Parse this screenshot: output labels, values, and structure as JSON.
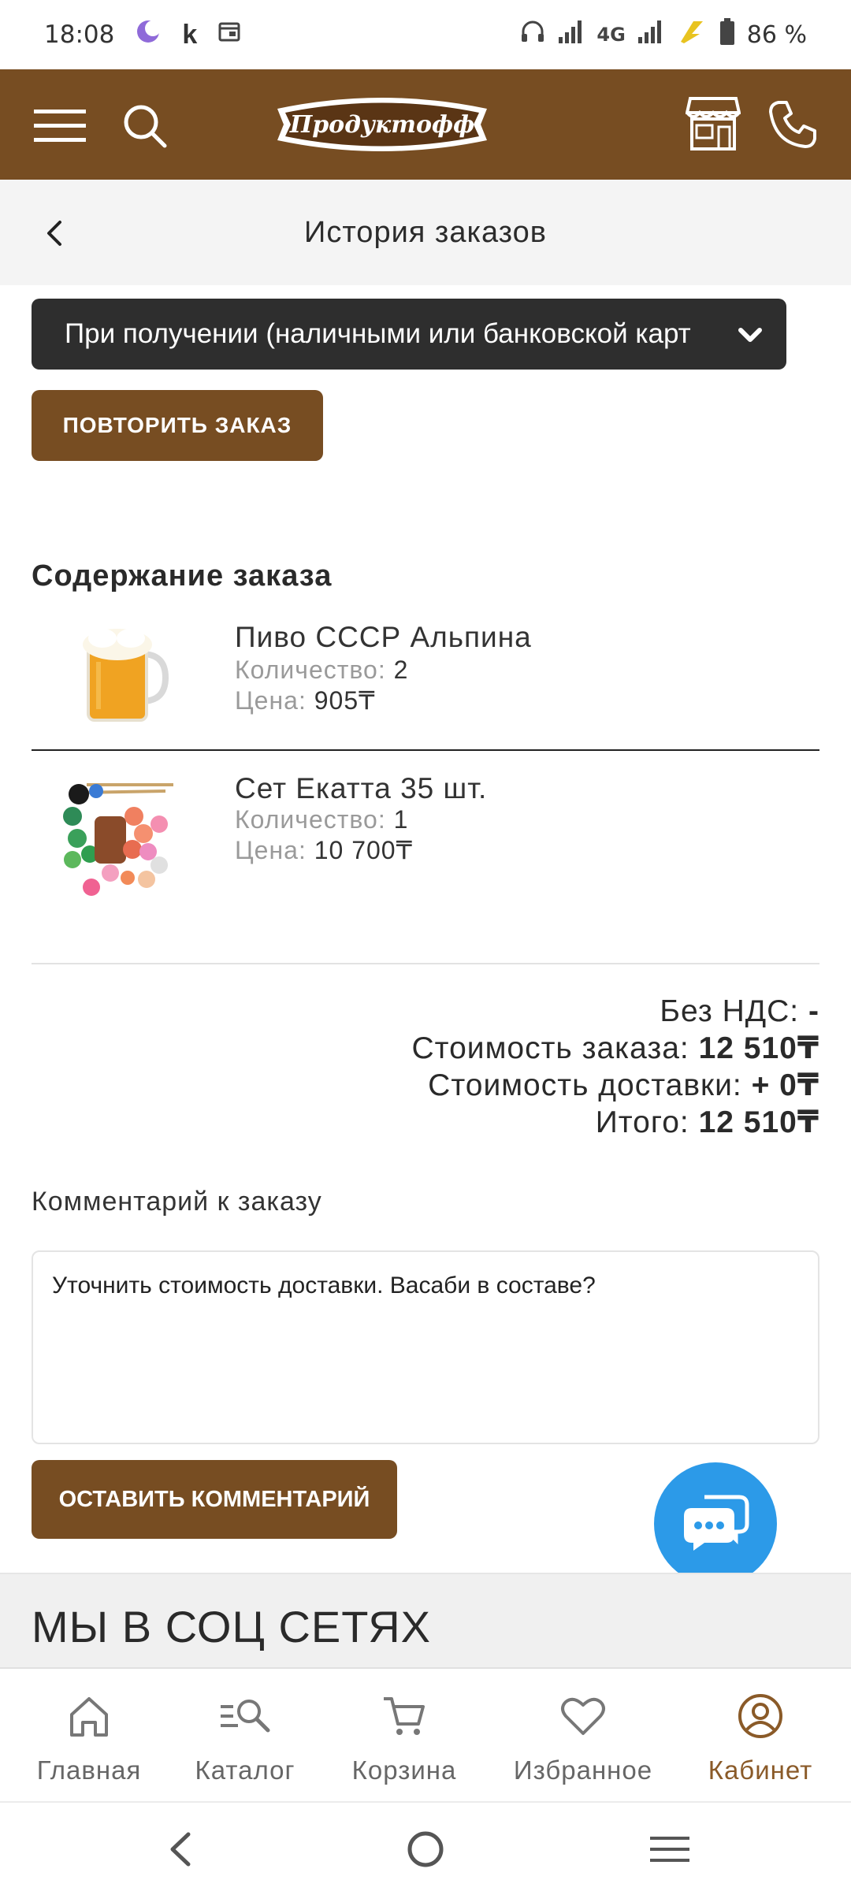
{
  "status_bar": {
    "time": "18:08",
    "network": "4G",
    "battery": "86 %"
  },
  "header": {
    "logo_text": "Продуктофф",
    "colors": {
      "brand": "#774d22"
    }
  },
  "page": {
    "title": "История заказов"
  },
  "order": {
    "payment_method": "При получении (наличными или банковской карт",
    "repeat_button": "ПОВТОРИТЬ ЗАКАЗ",
    "contents_title": "Содержание заказа",
    "items": [
      {
        "name": "Пиво СССР Альпина",
        "qty_label": "Количество:",
        "qty": "2",
        "price_label": "Цена:",
        "price": "905₸"
      },
      {
        "name": "Сет Екатта 35 шт.",
        "qty_label": "Количество:",
        "qty": "1",
        "price_label": "Цена:",
        "price": "10 700₸"
      }
    ],
    "totals": {
      "vat_label": "Без НДС:",
      "vat_value": "-",
      "order_cost_label": "Стоимость заказа:",
      "order_cost_value": "12 510₸",
      "delivery_label": "Стоимость доставки:",
      "delivery_value": "+ 0₸",
      "total_label": "Итого:",
      "total_value": "12 510₸"
    },
    "comment_label": "Комментарий к заказу",
    "comment_text": "Уточнить стоимость доставки. Васаби в составе?",
    "comment_button": "ОСТАВИТЬ КОММЕНТАРИЙ"
  },
  "social": {
    "title": "МЫ В СОЦ СЕТЯХ"
  },
  "bottom_nav": {
    "items": [
      {
        "label": "Главная",
        "icon": "home-icon"
      },
      {
        "label": "Каталог",
        "icon": "catalog-search-icon"
      },
      {
        "label": "Корзина",
        "icon": "cart-icon"
      },
      {
        "label": "Избранное",
        "icon": "heart-icon"
      },
      {
        "label": "Кабинет",
        "icon": "account-icon",
        "active": true
      }
    ]
  }
}
